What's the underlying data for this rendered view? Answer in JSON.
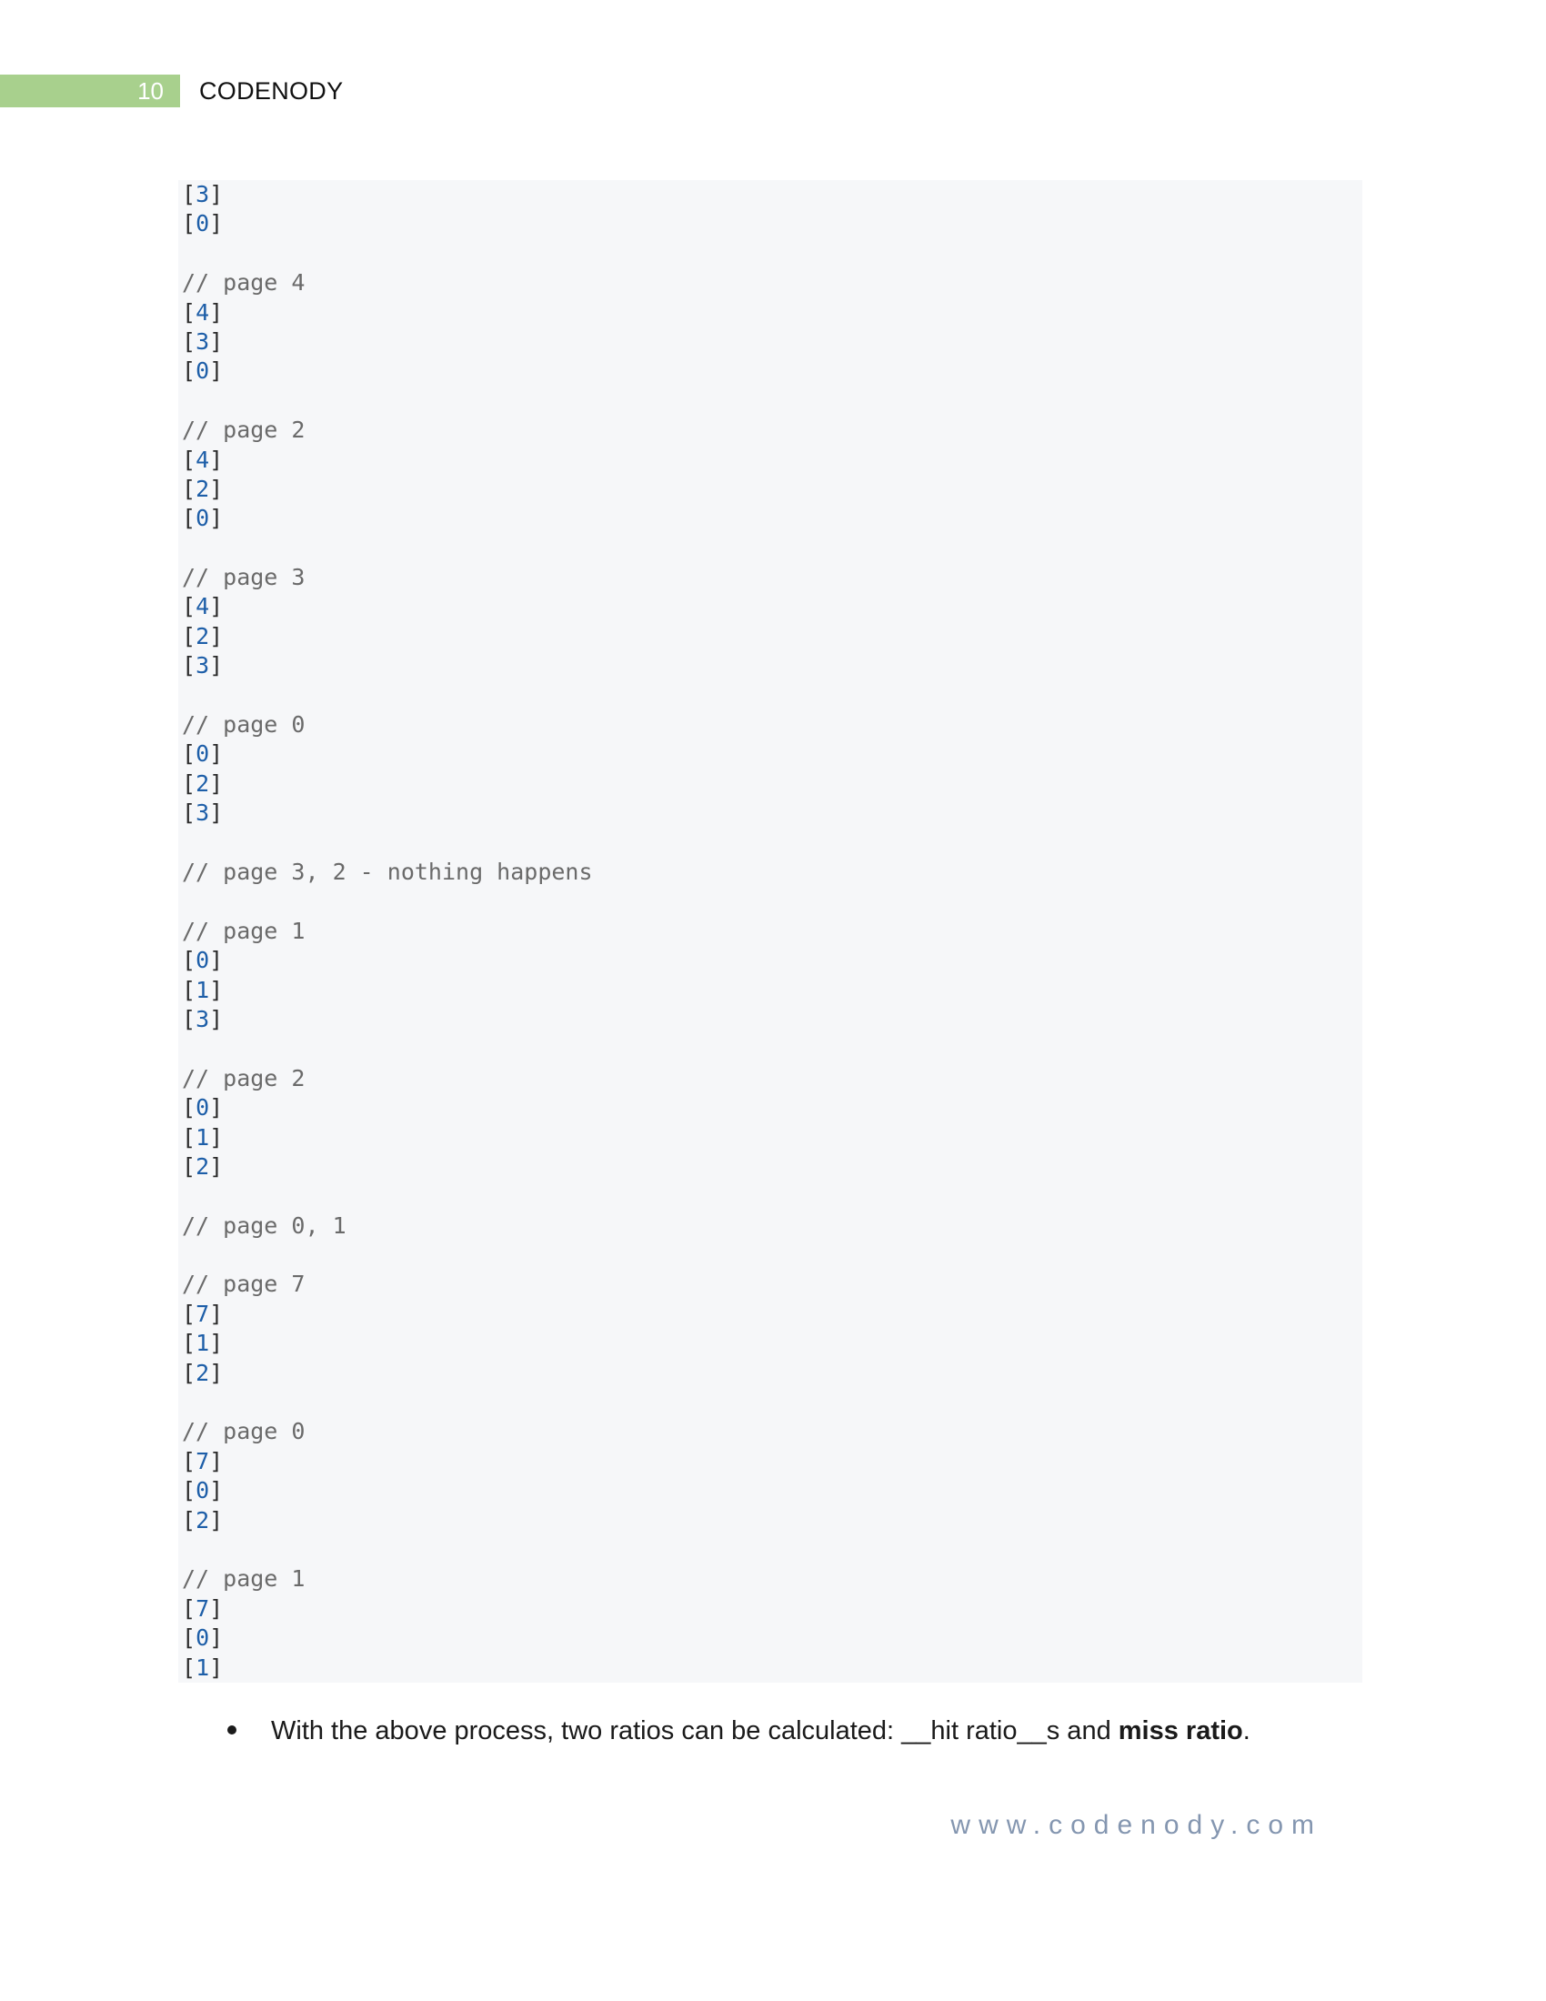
{
  "header": {
    "page_number": "10",
    "brand": "CODENODY"
  },
  "code": [
    {
      "kind": "frame",
      "value": "3"
    },
    {
      "kind": "frame",
      "value": "0"
    },
    {
      "kind": "blank"
    },
    {
      "kind": "comment",
      "text": "// page 4"
    },
    {
      "kind": "frame",
      "value": "4"
    },
    {
      "kind": "frame",
      "value": "3"
    },
    {
      "kind": "frame",
      "value": "0"
    },
    {
      "kind": "blank"
    },
    {
      "kind": "comment",
      "text": "// page 2"
    },
    {
      "kind": "frame",
      "value": "4"
    },
    {
      "kind": "frame",
      "value": "2"
    },
    {
      "kind": "frame",
      "value": "0"
    },
    {
      "kind": "blank"
    },
    {
      "kind": "comment",
      "text": "// page 3"
    },
    {
      "kind": "frame",
      "value": "4"
    },
    {
      "kind": "frame",
      "value": "2"
    },
    {
      "kind": "frame",
      "value": "3"
    },
    {
      "kind": "blank"
    },
    {
      "kind": "comment",
      "text": "// page 0"
    },
    {
      "kind": "frame",
      "value": "0"
    },
    {
      "kind": "frame",
      "value": "2"
    },
    {
      "kind": "frame",
      "value": "3"
    },
    {
      "kind": "blank"
    },
    {
      "kind": "comment",
      "text": "// page 3, 2 - nothing happens"
    },
    {
      "kind": "blank"
    },
    {
      "kind": "comment",
      "text": "// page 1"
    },
    {
      "kind": "frame",
      "value": "0"
    },
    {
      "kind": "frame",
      "value": "1"
    },
    {
      "kind": "frame",
      "value": "3"
    },
    {
      "kind": "blank"
    },
    {
      "kind": "comment",
      "text": "// page 2"
    },
    {
      "kind": "frame",
      "value": "0"
    },
    {
      "kind": "frame",
      "value": "1"
    },
    {
      "kind": "frame",
      "value": "2"
    },
    {
      "kind": "blank"
    },
    {
      "kind": "comment",
      "text": "// page 0, 1"
    },
    {
      "kind": "blank"
    },
    {
      "kind": "comment",
      "text": "// page 7"
    },
    {
      "kind": "frame",
      "value": "7"
    },
    {
      "kind": "frame",
      "value": "1"
    },
    {
      "kind": "frame",
      "value": "2"
    },
    {
      "kind": "blank"
    },
    {
      "kind": "comment",
      "text": "// page 0"
    },
    {
      "kind": "frame",
      "value": "7"
    },
    {
      "kind": "frame",
      "value": "0"
    },
    {
      "kind": "frame",
      "value": "2"
    },
    {
      "kind": "blank"
    },
    {
      "kind": "comment",
      "text": "// page 1"
    },
    {
      "kind": "frame",
      "value": "7"
    },
    {
      "kind": "frame",
      "value": "0"
    },
    {
      "kind": "frame",
      "value": "1"
    }
  ],
  "bullet": {
    "text_before": "With the above process, two ratios can be calculated: __hit ratio__s and ",
    "bold_text": "miss ratio",
    "text_after": "."
  },
  "footer": {
    "url": "www.codenody.com"
  }
}
